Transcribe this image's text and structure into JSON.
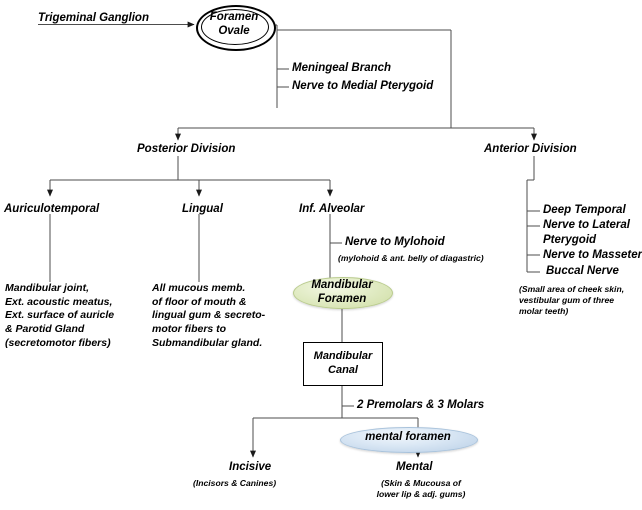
{
  "diagram": {
    "title_nodes": {
      "trigeminal_ganglion": "Trigeminal Ganglion",
      "foramen_ovale_line1": "Foramen",
      "foramen_ovale_line2": "Ovale"
    },
    "trunk_branches": [
      "Meningeal Branch",
      "Nerve to Medial Pterygoid"
    ],
    "divisions": {
      "posterior": "Posterior Division",
      "anterior": "Anterior Division"
    },
    "posterior_branches": [
      "Auriculotemporal",
      "Lingual",
      "Inf. Alveolar"
    ],
    "auriculotemporal_detail": "Mandibular joint,\nExt. acoustic meatus,\nExt. surface of auricle\n& Parotid Gland\n(secretomotor fibers)",
    "lingual_detail": "All mucous memb.\nof floor of mouth &\nlingual gum & secreto-\nmotor fibers to\nSubmandibular gland.",
    "inf_alveolar": {
      "mylohoid_branch": "Nerve to Mylohoid",
      "mylohoid_note": "(mylohoid & ant. belly of diagastric)",
      "mandibular_foramen_l1": "Mandibular",
      "mandibular_foramen_l2": "Foramen",
      "mandibular_canal_l1": "Mandibular",
      "mandibular_canal_l2": "Canal",
      "premolars_molars": "2 Premolars & 3 Molars",
      "mental_foramen": "mental foramen",
      "incisive": "Incisive",
      "incisive_note": "(Incisors & Canines)",
      "mental": "Mental",
      "mental_note": "(Skin & Mucousa of\nlower lip & adj. gums)"
    },
    "anterior_branches": [
      "Deep Temporal",
      "Nerve to Lateral",
      "Pterygoid",
      "Nerve to Masseter",
      "Buccal Nerve"
    ],
    "buccal_note": "(Small area of cheek skin,\n  vestibular gum of three\n  molar teeth)",
    "colors": {
      "line": "#4d4d4d",
      "stroke": "#000000",
      "green_ellipse": "#dfe9c2",
      "blue_ellipse": "#cfe0ef",
      "background": "#ffffff"
    }
  }
}
